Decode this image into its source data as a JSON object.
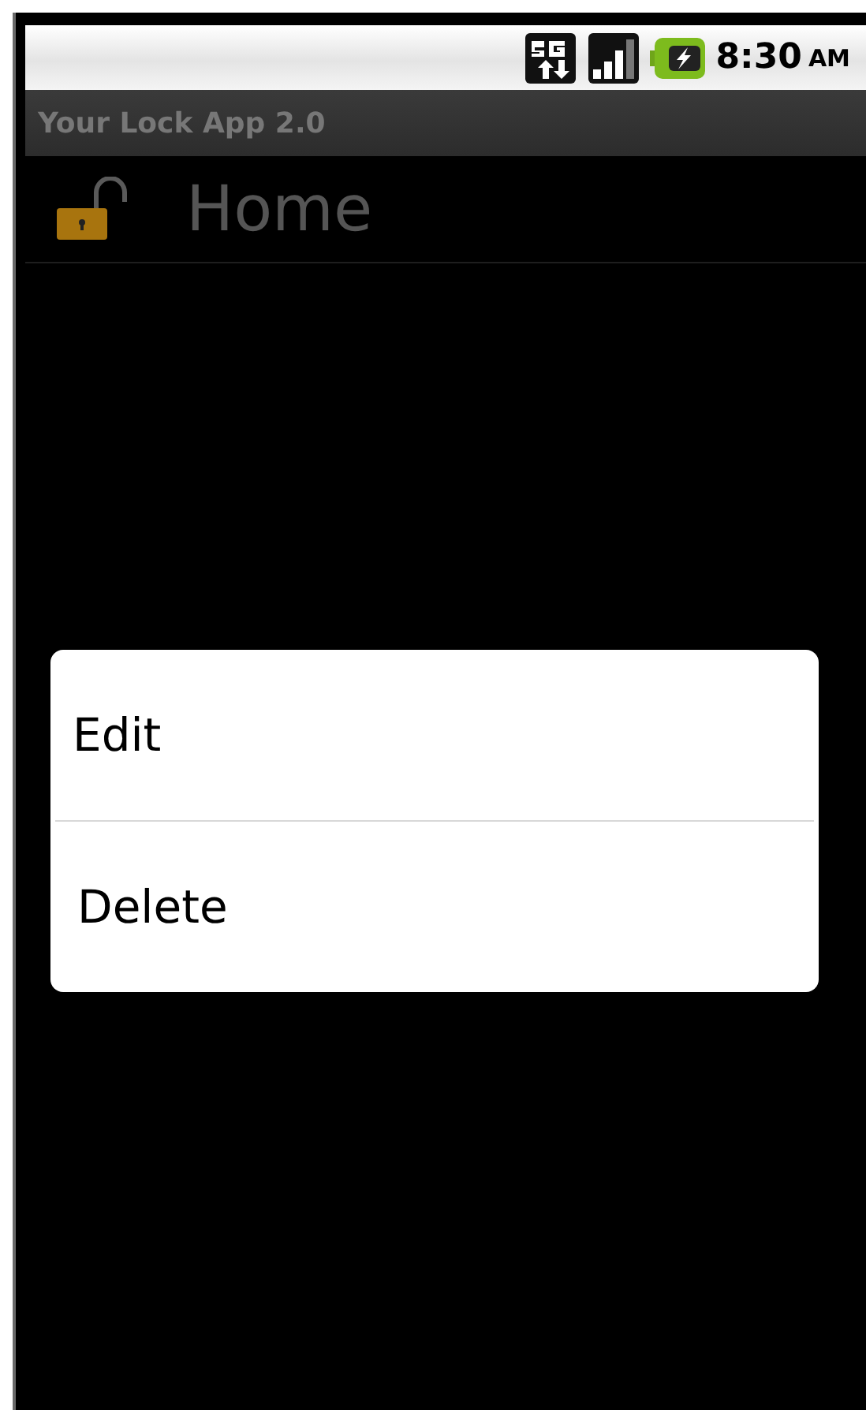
{
  "status_bar": {
    "time": "8:30",
    "period": "AM"
  },
  "title_bar": {
    "title": "Your Lock App 2.0"
  },
  "header": {
    "title": "Home",
    "locked": false
  },
  "context_menu": {
    "items": [
      {
        "label": "Edit"
      },
      {
        "label": "Delete"
      }
    ]
  }
}
